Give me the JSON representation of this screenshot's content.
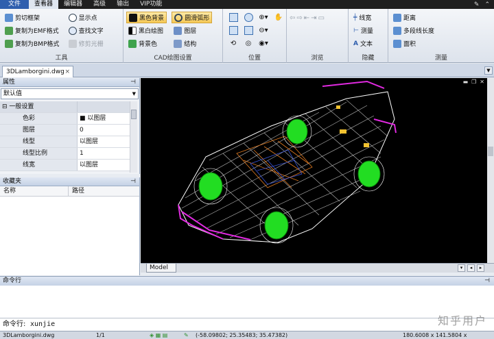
{
  "menubar": {
    "file": "文件",
    "tabs": [
      "查看器",
      "编辑器",
      "高级",
      "输出",
      "VIP功能"
    ]
  },
  "ribbon": {
    "tools": {
      "label": "工具",
      "clip_frame": "剪切框架",
      "copy_emf": "复制为EMF格式",
      "copy_bmp": "复制为BMP格式",
      "show_points": "显示点",
      "find_text": "查找文字",
      "trim_raster": "修剪光栅"
    },
    "cad_settings": {
      "label": "CAD绘图设置",
      "black_bg": "黑色背景",
      "bw_drawing": "黑白绘图",
      "bg_color": "背景色",
      "smooth_arc": "圆滑弧形",
      "layers": "图层",
      "structure": "结构"
    },
    "position": {
      "label": "位置"
    },
    "browse": {
      "label": "浏览"
    },
    "hide": {
      "label": "隐藏",
      "line_width": "线宽",
      "measure": "测量",
      "text": "文本"
    },
    "measure": {
      "label": "测量",
      "distance": "距离",
      "polyline_length": "多段线长度",
      "area": "面积"
    }
  },
  "doc": {
    "tab": "3DLamborgini.dwg"
  },
  "properties": {
    "title": "属性",
    "selected": "默认值",
    "category": "一般设置",
    "rows": [
      {
        "key": "色彩",
        "value": "■ 以图层"
      },
      {
        "key": "图层",
        "value": "0"
      },
      {
        "key": "线型",
        "value": "以图层"
      },
      {
        "key": "线型比例",
        "value": "1"
      },
      {
        "key": "线宽",
        "value": "以图层"
      }
    ]
  },
  "favorites": {
    "title": "收藏夹",
    "col_name": "名称",
    "col_path": "路径"
  },
  "model_tab": "Model",
  "command": {
    "title": "命令行",
    "label": "命令行:",
    "value": "xunjie"
  },
  "status": {
    "file": "3DLamborgini.dwg",
    "page": "1/1",
    "coords": "(-58.09802; 25.35483; 35.47382)",
    "size": "180.6008 x 141.5804 x 173.8424"
  },
  "watermark": "知乎用户",
  "colors": {
    "accent": "#2f5fae",
    "wheel": "#22dd22",
    "canvas_bg": "#000000"
  }
}
